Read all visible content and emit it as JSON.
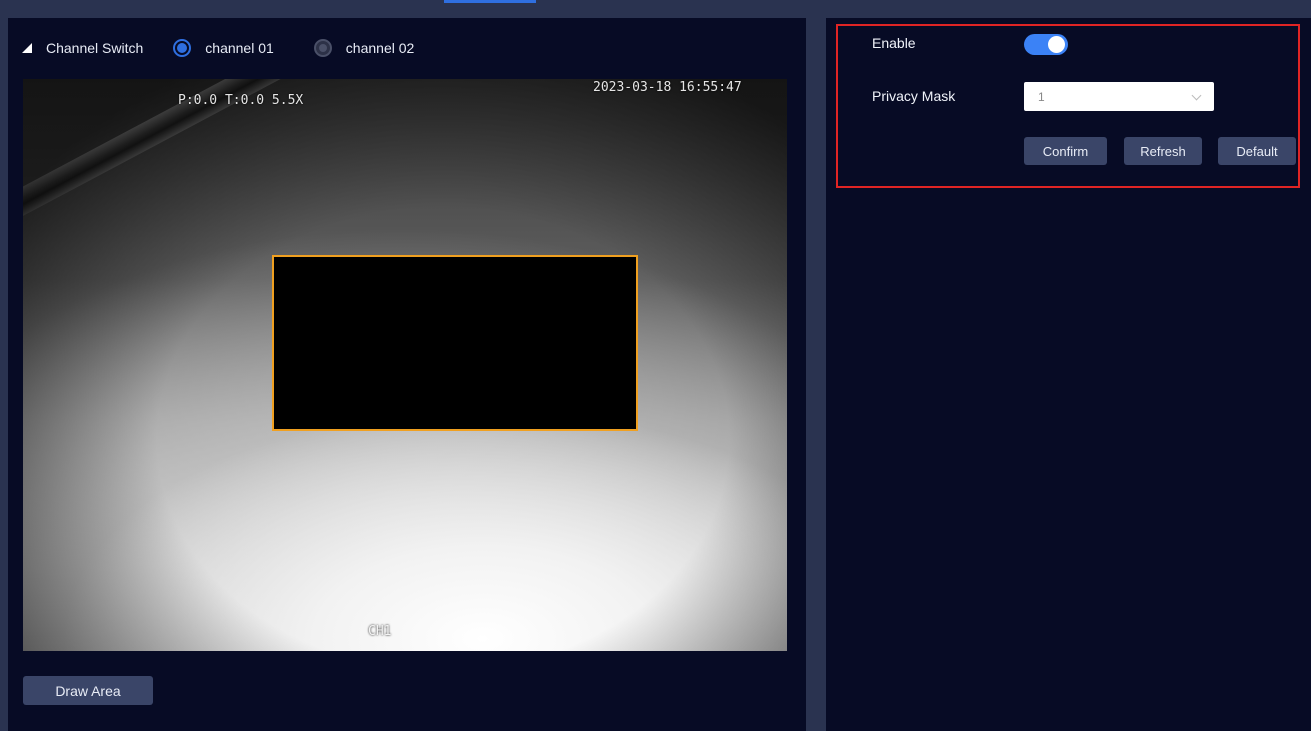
{
  "channel_switch": {
    "label": "Channel Switch",
    "options": [
      {
        "label": "channel 01",
        "selected": true
      },
      {
        "label": "channel 02",
        "selected": false
      }
    ]
  },
  "video": {
    "osd_ptz": "P:0.0 T:0.0 5.5X",
    "osd_timestamp": "2023-03-18 16:55:47",
    "osd_channel": "CH1"
  },
  "draw_area_label": "Draw Area",
  "settings": {
    "enable_label": "Enable",
    "enable_on": true,
    "privacy_mask_label": "Privacy Mask",
    "privacy_mask_value": "1",
    "confirm_label": "Confirm",
    "refresh_label": "Refresh",
    "default_label": "Default"
  },
  "colors": {
    "accent": "#3b82f6",
    "highlight_border": "#e02424",
    "mask_border": "#f0a020",
    "panel_bg": "#070b25"
  },
  "icons": {
    "collapse": "triangle-collapse-icon",
    "dropdown": "chevron-down-icon"
  }
}
